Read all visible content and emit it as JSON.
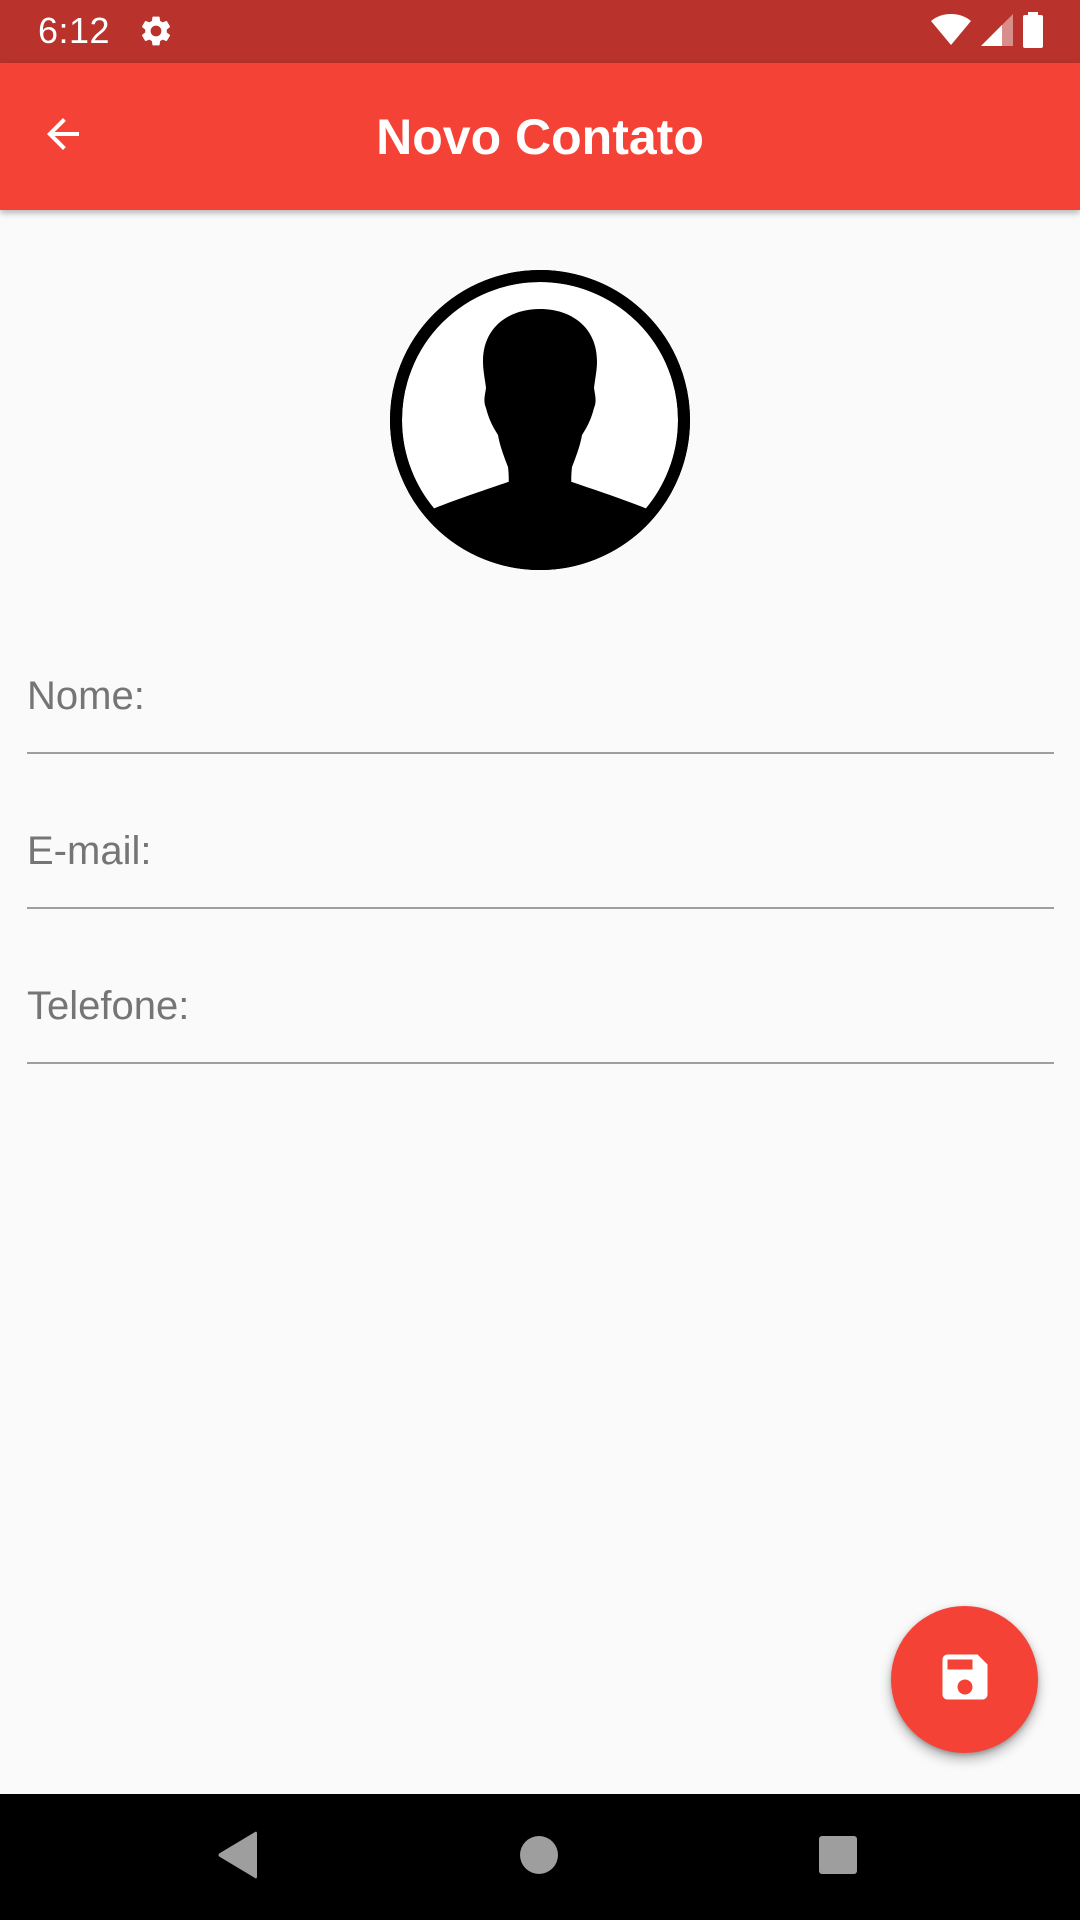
{
  "status_bar": {
    "time": "6:12",
    "icons": [
      "settings-gear-icon",
      "wifi-icon",
      "cell-signal-icon",
      "battery-icon"
    ],
    "background": "#b9322b"
  },
  "app_bar": {
    "title": "Novo Contato",
    "back_icon": "arrow-back-icon",
    "background": "#f44336"
  },
  "avatar": {
    "icon": "person-placeholder-icon"
  },
  "form": {
    "fields": [
      {
        "label": "Nome:",
        "value": ""
      },
      {
        "label": "E-mail:",
        "value": ""
      },
      {
        "label": "Telefone:",
        "value": ""
      }
    ]
  },
  "fab": {
    "icon": "save-floppy-icon",
    "color": "#f44336"
  },
  "nav_bar": {
    "buttons": [
      "nav-back-icon",
      "nav-home-icon",
      "nav-recents-icon"
    ]
  }
}
